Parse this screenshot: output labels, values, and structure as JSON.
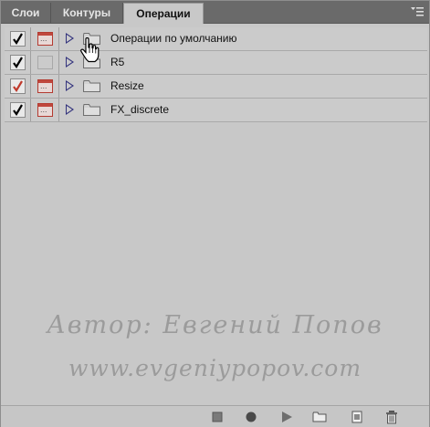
{
  "tabs": [
    {
      "label": "Слои",
      "active": false
    },
    {
      "label": "Контуры",
      "active": false
    },
    {
      "label": "Операции",
      "active": true
    }
  ],
  "actions": [
    {
      "name": "Операции по умолчанию",
      "checked": true,
      "check_color": "#000000",
      "dialog": true
    },
    {
      "name": "R5",
      "checked": true,
      "check_color": "#000000",
      "dialog": false
    },
    {
      "name": "Resize",
      "checked": true,
      "check_color": "#c0392b",
      "dialog": true
    },
    {
      "name": "FX_discrete",
      "checked": true,
      "check_color": "#000000",
      "dialog": true
    }
  ],
  "watermark": {
    "line1": "Автор: Евгений Попов",
    "line2": "www.evgeniypopov.com"
  },
  "icons": {
    "panel_menu": "panel-menu-icon",
    "stop": "stop-icon",
    "record": "record-icon",
    "play": "play-icon",
    "new_set": "folder-icon",
    "new_action": "new-action-icon",
    "delete": "trash-icon"
  },
  "colors": {
    "panel_bg": "#c8c8c8",
    "tab_bar": "#6a6a6a",
    "dialog_icon": "#c0473d",
    "triangle": "#34347e"
  }
}
